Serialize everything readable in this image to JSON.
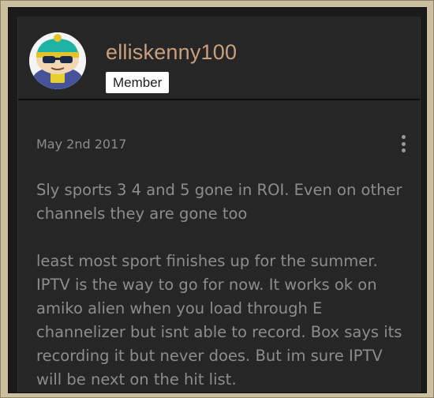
{
  "post": {
    "author": {
      "username": "elliskenny100",
      "role_badge": "Member",
      "avatar_icon": "cartman-avatar"
    },
    "date": "May 2nd 2017",
    "menu_icon": "vertical-ellipsis-icon",
    "paragraphs": [
      "Sly sports 3 4 and 5 gone in ROI. Even on other channels they are gone too",
      "least most sport finishes up for the summer. IPTV is the way to go for now. It works ok on amiko alien when you load through E channelizer but isnt able to record. Box says its recording it but never does. But im sure IPTV will be next on the hit list."
    ]
  },
  "colors": {
    "username": "#c9a07e",
    "panel_bg": "#1b1b1b",
    "card_bg": "#262626",
    "frame_bg": "#cbbf9f",
    "body_text": "#8d8d8d"
  }
}
